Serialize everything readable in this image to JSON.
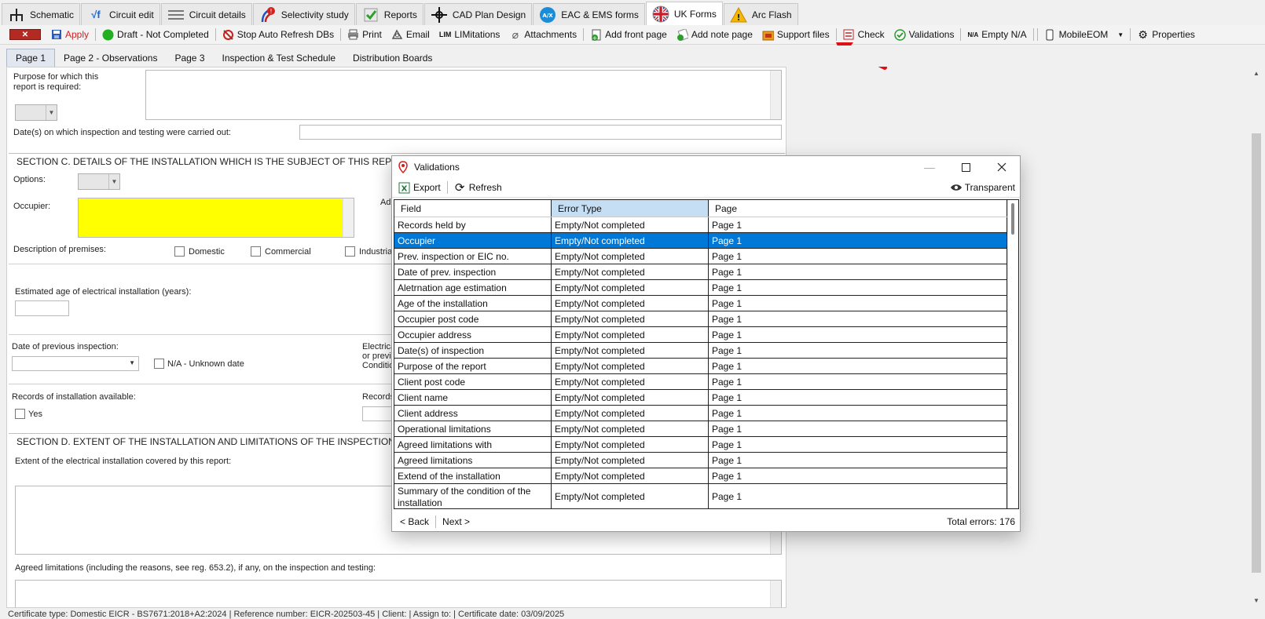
{
  "top_tabs": [
    {
      "label": "Schematic",
      "icon": "schematic-icon",
      "active": false
    },
    {
      "label": "Circuit edit",
      "icon": "circuit-edit-icon",
      "active": false
    },
    {
      "label": "Circuit details",
      "icon": "circuit-details-icon",
      "active": false
    },
    {
      "label": "Selectivity study",
      "icon": "selectivity-icon",
      "active": false
    },
    {
      "label": "Reports",
      "icon": "reports-icon",
      "active": false
    },
    {
      "label": "CAD Plan Design",
      "icon": "cad-icon",
      "active": false
    },
    {
      "label": "EAC & EMS forms",
      "icon": "eac-icon",
      "active": false
    },
    {
      "label": "UK Forms",
      "icon": "uk-flag-icon",
      "active": true
    },
    {
      "label": "Arc Flash",
      "icon": "warning-icon",
      "active": false
    }
  ],
  "toolbar": {
    "apply": "Apply",
    "draft": "Draft - Not Completed",
    "stop_refresh": "Stop Auto Refresh DBs",
    "print": "Print",
    "email": "Email",
    "limitations_prefix": "LIM",
    "limitations": "LIMitations",
    "attachments": "Attachments",
    "add_front_page": "Add front page",
    "add_note_page": "Add note page",
    "support_files": "Support files",
    "check": "Check",
    "validations": "Validations",
    "empty_na_prefix": "N/A",
    "empty_na": "Empty N/A",
    "mobile_eom": "MobileEOM",
    "properties": "Properties"
  },
  "page_tabs": [
    {
      "label": "Page 1",
      "active": true
    },
    {
      "label": "Page 2 - Observations",
      "active": false
    },
    {
      "label": "Page 3",
      "active": false
    },
    {
      "label": "Inspection & Test Schedule",
      "active": false
    },
    {
      "label": "Distribution Boards",
      "active": false
    }
  ],
  "form": {
    "purpose_label": "Purpose for which this report is required:",
    "dates_label": "Date(s) on which inspection and testing were carried out:",
    "section_c": "SECTION C. DETAILS OF THE INSTALLATION WHICH IS THE SUBJECT OF THIS REPORT",
    "options_label": "Options:",
    "occupier_label": "Occupier:",
    "address_label_partial": "Add",
    "description_label": "Description of premises:",
    "domestic": "Domestic",
    "commercial": "Commercial",
    "industrial": "Industrial",
    "estimated_age_label": "Estimated age of electrical installation (years):",
    "prev_inspection_label": "Date of previous inspection:",
    "na_unknown_date": "N/A - Unknown date",
    "electrical_partial_1": "Electrica",
    "electrical_partial_2": "or previc",
    "electrical_partial_3": "Conditio",
    "records_available_label": "Records of installation available:",
    "yes": "Yes",
    "records_partial": "Records",
    "section_d": "SECTION D. EXTENT OF THE INSTALLATION AND LIMITATIONS OF THE INSPECTION AND TE",
    "extent_label": "Extent of the electrical installation covered by this report:",
    "agreed_limitations_label": "Agreed limitations (including the reasons, see reg. 653.2), if any, on the inspection and testing:"
  },
  "status_bar": "Certificate type: Domestic EICR - BS7671:2018+A2:2024  |  Reference number: EICR-202503-45  |  Client:  |  Assign to:  |  Certificate date: 03/09/2025",
  "validations": {
    "title": "Validations",
    "export": "Export",
    "refresh": "Refresh",
    "transparent": "Transparent",
    "columns": [
      "Field",
      "Error Type",
      "Page"
    ],
    "rows": [
      {
        "field": "Records held by",
        "error": "Empty/Not completed",
        "page": "Page 1"
      },
      {
        "field": "Occupier",
        "error": "Empty/Not completed",
        "page": "Page 1"
      },
      {
        "field": "Prev. inspection or EIC no.",
        "error": "Empty/Not completed",
        "page": "Page 1"
      },
      {
        "field": "Date of prev. inspection",
        "error": "Empty/Not completed",
        "page": "Page 1"
      },
      {
        "field": "Aletrnation age estimation",
        "error": "Empty/Not completed",
        "page": "Page 1"
      },
      {
        "field": "Age of the installation",
        "error": "Empty/Not completed",
        "page": "Page 1"
      },
      {
        "field": "Occupier post code",
        "error": "Empty/Not completed",
        "page": "Page 1"
      },
      {
        "field": "Occupier address",
        "error": "Empty/Not completed",
        "page": "Page 1"
      },
      {
        "field": "Date(s) of inspection",
        "error": "Empty/Not completed",
        "page": "Page 1"
      },
      {
        "field": "Purpose of the report",
        "error": "Empty/Not completed",
        "page": "Page 1"
      },
      {
        "field": "Client post code",
        "error": "Empty/Not completed",
        "page": "Page 1"
      },
      {
        "field": "Client name",
        "error": "Empty/Not completed",
        "page": "Page 1"
      },
      {
        "field": "Client address",
        "error": "Empty/Not completed",
        "page": "Page 1"
      },
      {
        "field": "Operational limitations",
        "error": "Empty/Not completed",
        "page": "Page 1"
      },
      {
        "field": "Agreed limitations with",
        "error": "Empty/Not completed",
        "page": "Page 1"
      },
      {
        "field": "Agreed limitations",
        "error": "Empty/Not completed",
        "page": "Page 1"
      },
      {
        "field": "Extend of the installation",
        "error": "Empty/Not completed",
        "page": "Page 1"
      },
      {
        "field": "Summary of the condition of the installation",
        "error": "Empty/Not completed",
        "page": "Page 1"
      }
    ],
    "selected_row": 1,
    "back": "< Back",
    "next": "Next >",
    "total_errors": "Total errors: 176"
  },
  "colors": {
    "selection": "#0078d7",
    "occupier_highlight": "#ffff00",
    "annotation_arrow": "#e01010",
    "sorted_header": "#c6def4"
  }
}
